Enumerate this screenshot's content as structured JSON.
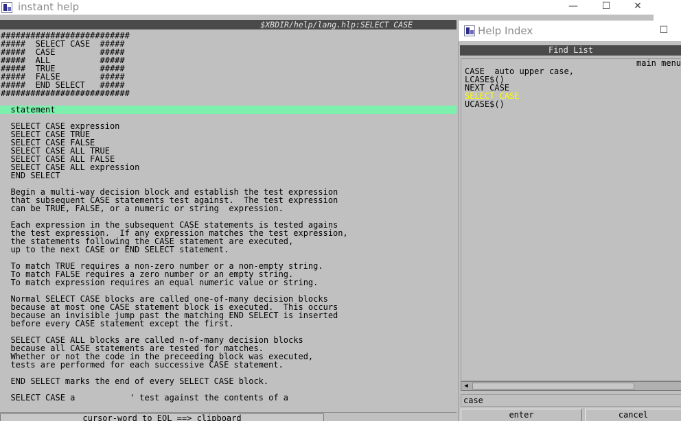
{
  "main_window": {
    "title": "instant help",
    "controls": {
      "minimize": "—",
      "maximize": "☐",
      "close": "✕"
    },
    "header_path": "$XBDIR/help/lang.hlp:SELECT CASE",
    "lines": [
      "##########################",
      "#####  SELECT CASE  #####",
      "#####  CASE         #####",
      "#####  ALL          #####",
      "#####  TRUE         #####",
      "#####  FALSE        #####",
      "#####  END SELECT   #####",
      "##########################",
      "",
      "  statement",
      "",
      "  SELECT CASE expression",
      "  SELECT CASE TRUE",
      "  SELECT CASE FALSE",
      "  SELECT CASE ALL TRUE",
      "  SELECT CASE ALL FALSE",
      "  SELECT CASE ALL expression",
      "  END SELECT",
      "",
      "  Begin a multi-way decision block and establish the test expression",
      "  that subsequent CASE statements test against.  The test expression",
      "  can be TRUE, FALSE, or a numeric or string  expression.",
      "",
      "  Each expression in the subsequent CASE statements is tested agains",
      "  the test expression.  If any expression matches the test expression,",
      "  the statements following the CASE statement are executed,",
      "  up to the next CASE or END SELECT statement.",
      "",
      "  To match TRUE requires a non-zero number or a non-empty string.",
      "  To match FALSE requires a zero number or an empty string.",
      "  To match expression requires an equal numeric value or string.",
      "",
      "  Normal SELECT CASE blocks are called one-of-many decision blocks",
      "  because at most one CASE statement block is executed.  This occurs",
      "  because an invisible jump past the matching END SELECT is inserted",
      "  before every CASE statement except the first.",
      "",
      "  SELECT CASE ALL blocks are called n-of-many decision blocks",
      "  because all CASE statements are tested for matches.",
      "  Whether or not the code in the preceeding block was executed,",
      "  tests are performed for each successive CASE statement.",
      "",
      "  END SELECT marks the end of every SELECT CASE block.",
      "",
      "  SELECT CASE a           ' test against the contents of a"
    ],
    "highlight_line_index": 9,
    "status_button": "cursor-word to EOL ==> clipboard"
  },
  "index_window": {
    "title": "Help  Index",
    "maximize": "☐",
    "find_list_header": "Find List",
    "first_item_left": "auto upper case,",
    "first_item_right": "main menu",
    "items": [
      "CASE",
      "LCASE$()",
      "NEXT CASE",
      "SELECT CASE",
      "UCASE$()"
    ],
    "selected_item": "SELECT CASE",
    "search_value": "case",
    "enter_button": "enter",
    "cancel_button": "cancel",
    "scroll_left_arrow": "◀"
  },
  "colors": {
    "highlight_bar": "#7ef0ae",
    "selected_item_text": "#ffff00",
    "panel_background": "#c0c0c0",
    "header_bar": "#4a4a4a"
  }
}
